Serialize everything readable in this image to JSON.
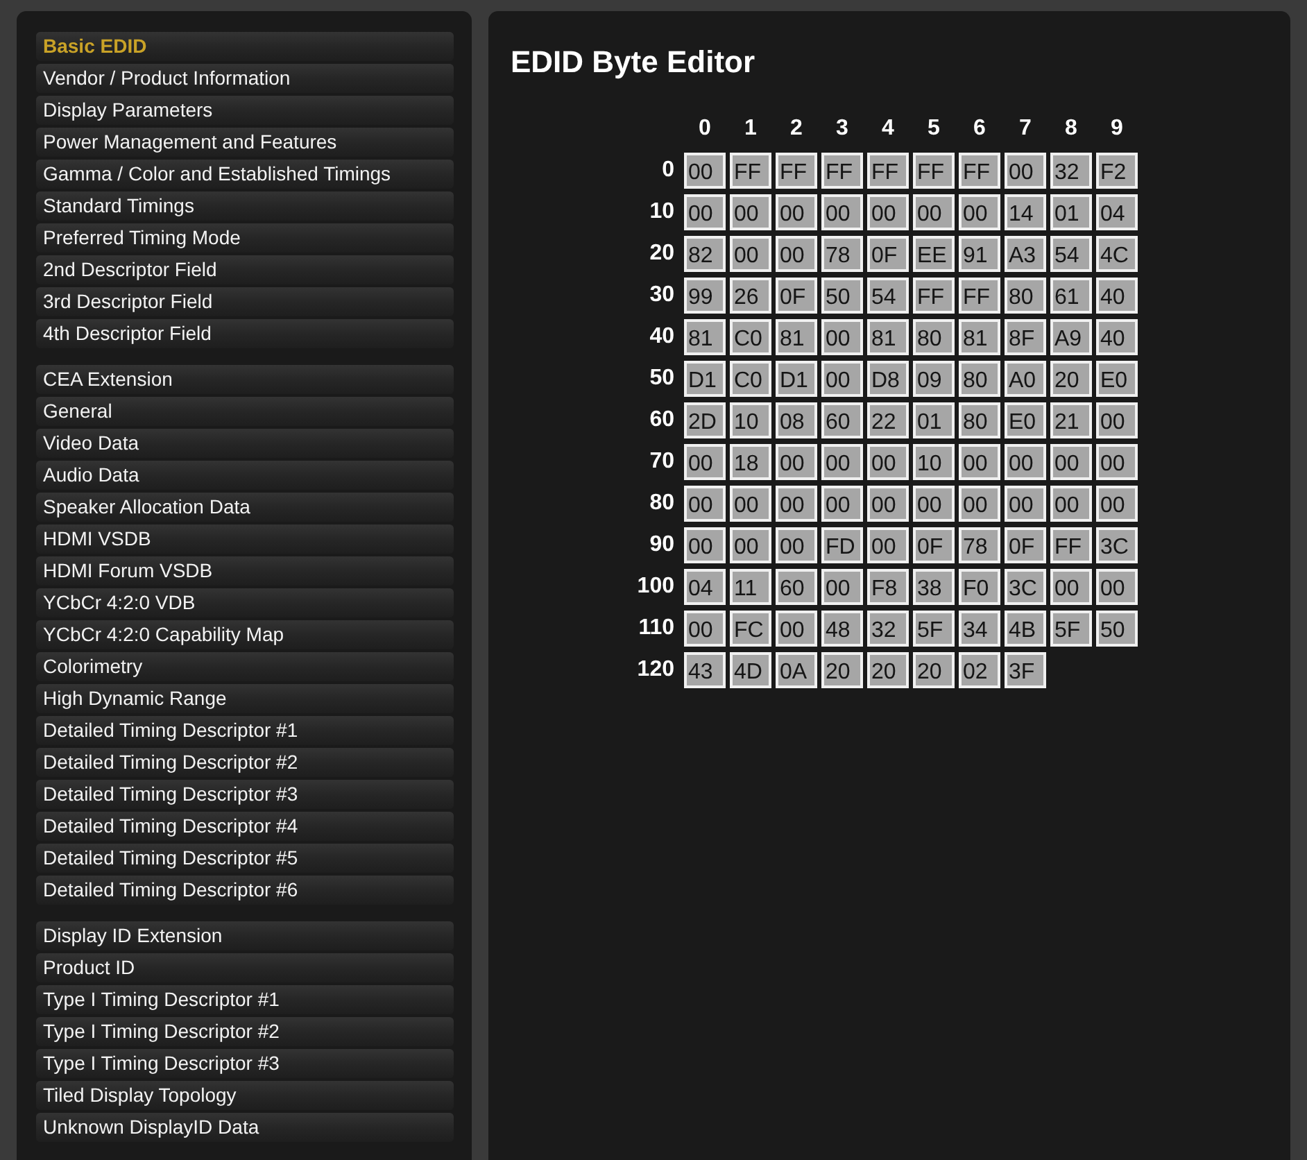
{
  "sidebar": {
    "groups": [
      {
        "items": [
          {
            "label": "Basic EDID",
            "selected": true
          },
          {
            "label": "Vendor / Product Information",
            "selected": false
          },
          {
            "label": "Display Parameters",
            "selected": false
          },
          {
            "label": "Power Management and Features",
            "selected": false
          },
          {
            "label": "Gamma / Color and Established Timings",
            "selected": false
          },
          {
            "label": "Standard Timings",
            "selected": false
          },
          {
            "label": "Preferred Timing Mode",
            "selected": false
          },
          {
            "label": "2nd Descriptor Field",
            "selected": false
          },
          {
            "label": "3rd Descriptor Field",
            "selected": false
          },
          {
            "label": "4th Descriptor Field",
            "selected": false
          }
        ]
      },
      {
        "items": [
          {
            "label": "CEA Extension",
            "selected": false
          },
          {
            "label": "General",
            "selected": false
          },
          {
            "label": "Video Data",
            "selected": false
          },
          {
            "label": "Audio Data",
            "selected": false
          },
          {
            "label": "Speaker Allocation Data",
            "selected": false
          },
          {
            "label": "HDMI VSDB",
            "selected": false
          },
          {
            "label": "HDMI Forum VSDB",
            "selected": false
          },
          {
            "label": "YCbCr 4:2:0 VDB",
            "selected": false
          },
          {
            "label": "YCbCr 4:2:0 Capability Map",
            "selected": false
          },
          {
            "label": "Colorimetry",
            "selected": false
          },
          {
            "label": "High Dynamic Range",
            "selected": false
          },
          {
            "label": "Detailed Timing Descriptor #1",
            "selected": false
          },
          {
            "label": "Detailed Timing Descriptor #2",
            "selected": false
          },
          {
            "label": "Detailed Timing Descriptor #3",
            "selected": false
          },
          {
            "label": "Detailed Timing Descriptor #4",
            "selected": false
          },
          {
            "label": "Detailed Timing Descriptor #5",
            "selected": false
          },
          {
            "label": "Detailed Timing Descriptor #6",
            "selected": false
          }
        ]
      },
      {
        "items": [
          {
            "label": "Display ID Extension",
            "selected": false
          },
          {
            "label": "Product ID",
            "selected": false
          },
          {
            "label": "Type I Timing Descriptor #1",
            "selected": false
          },
          {
            "label": "Type I Timing Descriptor #2",
            "selected": false
          },
          {
            "label": "Type I Timing Descriptor #3",
            "selected": false
          },
          {
            "label": "Tiled Display Topology",
            "selected": false
          },
          {
            "label": "Unknown DisplayID Data",
            "selected": false
          }
        ]
      }
    ]
  },
  "editor": {
    "title": "EDID Byte Editor",
    "column_headers": [
      "0",
      "1",
      "2",
      "3",
      "4",
      "5",
      "6",
      "7",
      "8",
      "9"
    ],
    "rows": [
      {
        "label": "0",
        "bytes": [
          "00",
          "FF",
          "FF",
          "FF",
          "FF",
          "FF",
          "FF",
          "00",
          "32",
          "F2"
        ]
      },
      {
        "label": "10",
        "bytes": [
          "00",
          "00",
          "00",
          "00",
          "00",
          "00",
          "00",
          "14",
          "01",
          "04"
        ]
      },
      {
        "label": "20",
        "bytes": [
          "82",
          "00",
          "00",
          "78",
          "0F",
          "EE",
          "91",
          "A3",
          "54",
          "4C"
        ]
      },
      {
        "label": "30",
        "bytes": [
          "99",
          "26",
          "0F",
          "50",
          "54",
          "FF",
          "FF",
          "80",
          "61",
          "40"
        ]
      },
      {
        "label": "40",
        "bytes": [
          "81",
          "C0",
          "81",
          "00",
          "81",
          "80",
          "81",
          "8F",
          "A9",
          "40"
        ]
      },
      {
        "label": "50",
        "bytes": [
          "D1",
          "C0",
          "D1",
          "00",
          "D8",
          "09",
          "80",
          "A0",
          "20",
          "E0"
        ]
      },
      {
        "label": "60",
        "bytes": [
          "2D",
          "10",
          "08",
          "60",
          "22",
          "01",
          "80",
          "E0",
          "21",
          "00"
        ]
      },
      {
        "label": "70",
        "bytes": [
          "00",
          "18",
          "00",
          "00",
          "00",
          "10",
          "00",
          "00",
          "00",
          "00"
        ]
      },
      {
        "label": "80",
        "bytes": [
          "00",
          "00",
          "00",
          "00",
          "00",
          "00",
          "00",
          "00",
          "00",
          "00"
        ]
      },
      {
        "label": "90",
        "bytes": [
          "00",
          "00",
          "00",
          "FD",
          "00",
          "0F",
          "78",
          "0F",
          "FF",
          "3C"
        ]
      },
      {
        "label": "100",
        "bytes": [
          "04",
          "11",
          "60",
          "00",
          "F8",
          "38",
          "F0",
          "3C",
          "00",
          "00"
        ]
      },
      {
        "label": "110",
        "bytes": [
          "00",
          "FC",
          "00",
          "48",
          "32",
          "5F",
          "34",
          "4B",
          "5F",
          "50"
        ]
      },
      {
        "label": "120",
        "bytes": [
          "43",
          "4D",
          "0A",
          "20",
          "20",
          "20",
          "02",
          "3F"
        ]
      }
    ]
  }
}
